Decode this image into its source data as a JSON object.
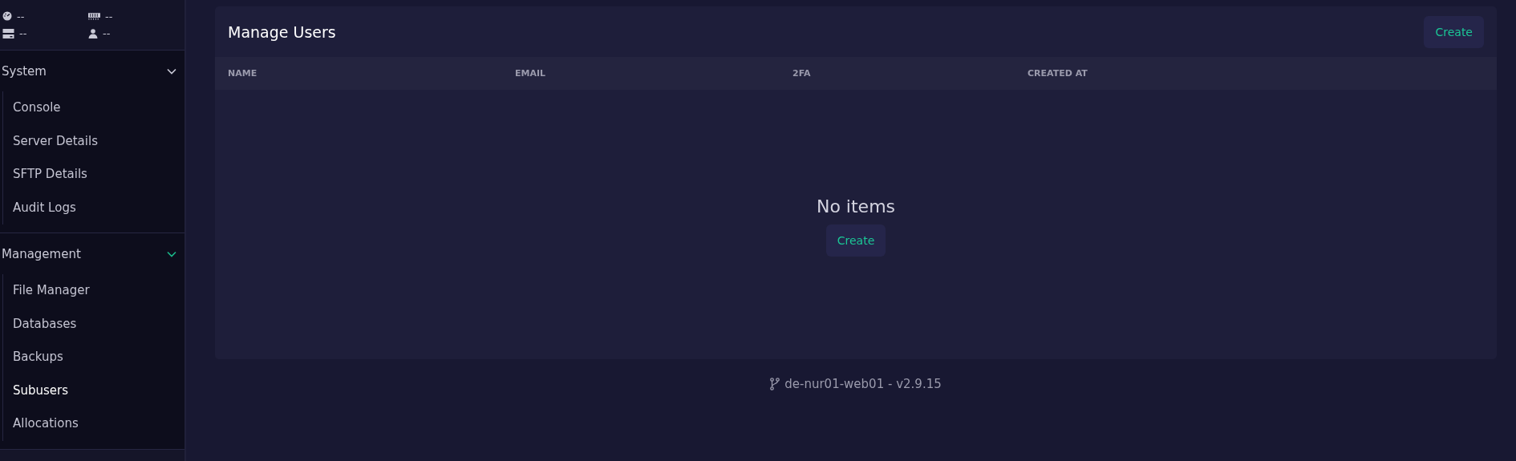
{
  "stats": [
    {
      "kind": "cpu",
      "value": "--"
    },
    {
      "kind": "memory",
      "value": "--"
    },
    {
      "kind": "disk",
      "value": "--"
    },
    {
      "kind": "users",
      "value": "--"
    }
  ],
  "sidebar": {
    "sections": [
      {
        "title": "System",
        "expanded": true,
        "active": false,
        "items": [
          {
            "label": "Console",
            "selected": false
          },
          {
            "label": "Server Details",
            "selected": false
          },
          {
            "label": "SFTP Details",
            "selected": false
          },
          {
            "label": "Audit Logs",
            "selected": false
          }
        ]
      },
      {
        "title": "Management",
        "expanded": true,
        "active": true,
        "items": [
          {
            "label": "File Manager",
            "selected": false
          },
          {
            "label": "Databases",
            "selected": false
          },
          {
            "label": "Backups",
            "selected": false
          },
          {
            "label": "Subusers",
            "selected": true
          },
          {
            "label": "Allocations",
            "selected": false
          }
        ]
      }
    ]
  },
  "card": {
    "title": "Manage Users",
    "create_button": "Create",
    "table": {
      "columns": [
        "NAME",
        "EMAIL",
        "2FA",
        "CREATED AT"
      ]
    },
    "empty": {
      "message": "No items",
      "button": "Create"
    }
  },
  "footer": {
    "text": "de-nur01-web01 - v2.9.15"
  }
}
